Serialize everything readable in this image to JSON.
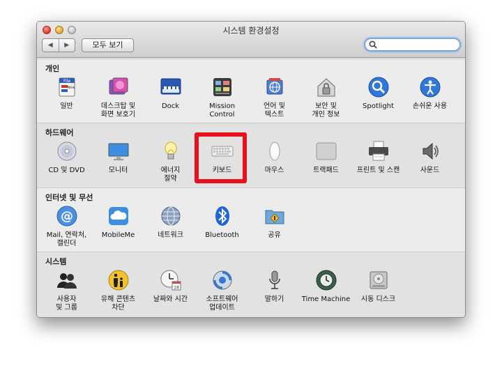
{
  "window": {
    "title": "시스템 환경설정",
    "nav_back": "◀",
    "nav_forward": "▶",
    "show_all": "모두 보기",
    "search_placeholder": ""
  },
  "sections": [
    {
      "title": "개인",
      "items": [
        {
          "label": "일반",
          "icon": "general-icon"
        },
        {
          "label": "데스크탑 및\n화면 보호기",
          "icon": "desktop-screensaver-icon"
        },
        {
          "label": "Dock",
          "icon": "dock-icon"
        },
        {
          "label": "Mission\nControl",
          "icon": "mission-control-icon"
        },
        {
          "label": "언어 및\n텍스트",
          "icon": "language-text-icon"
        },
        {
          "label": "보안 및\n개인 정보",
          "icon": "security-privacy-icon"
        },
        {
          "label": "Spotlight",
          "icon": "spotlight-icon"
        },
        {
          "label": "손쉬운 사용",
          "icon": "accessibility-icon"
        }
      ]
    },
    {
      "title": "하드웨어",
      "items": [
        {
          "label": "CD 및 DVD",
          "icon": "cd-dvd-icon"
        },
        {
          "label": "모니터",
          "icon": "monitor-icon"
        },
        {
          "label": "에너지\n절약",
          "icon": "energy-saver-icon"
        },
        {
          "label": "키보드",
          "icon": "keyboard-icon"
        },
        {
          "label": "마우스",
          "icon": "mouse-icon"
        },
        {
          "label": "트랙패드",
          "icon": "trackpad-icon"
        },
        {
          "label": "프린트 및 스캔",
          "icon": "printer-icon"
        },
        {
          "label": "사운드",
          "icon": "sound-icon"
        }
      ]
    },
    {
      "title": "인터넷 및 무선",
      "items": [
        {
          "label": "Mail, 연락처,\n캘린더",
          "icon": "mail-contacts-icon"
        },
        {
          "label": "MobileMe",
          "icon": "mobileme-icon"
        },
        {
          "label": "네트워크",
          "icon": "network-icon"
        },
        {
          "label": "Bluetooth",
          "icon": "bluetooth-icon"
        },
        {
          "label": "공유",
          "icon": "sharing-icon"
        }
      ]
    },
    {
      "title": "시스템",
      "items": [
        {
          "label": "사용자\n및 그룹",
          "icon": "users-groups-icon"
        },
        {
          "label": "유해 콘텐츠\n차단",
          "icon": "parental-controls-icon"
        },
        {
          "label": "날짜와 시간",
          "icon": "date-time-icon"
        },
        {
          "label": "소프트웨어\n업데이트",
          "icon": "software-update-icon"
        },
        {
          "label": "말하기",
          "icon": "speech-icon"
        },
        {
          "label": "Time Machine",
          "icon": "time-machine-icon"
        },
        {
          "label": "시동 디스크",
          "icon": "startup-disk-icon"
        }
      ]
    }
  ],
  "colors": {
    "highlight": "#e8101c",
    "search_ring": "#78a8e0"
  }
}
